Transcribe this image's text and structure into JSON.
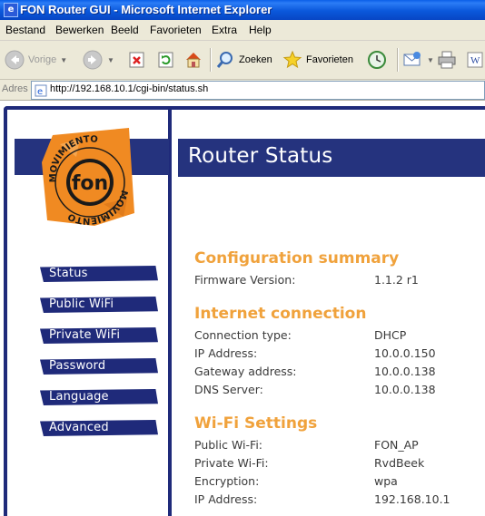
{
  "window": {
    "title": "FON Router GUI - Microsoft Internet Explorer"
  },
  "menu": [
    "Bestand",
    "Bewerken",
    "Beeld",
    "Favorieten",
    "Extra",
    "Help"
  ],
  "toolbar": {
    "back_label": "Vorige",
    "search_label": "Zoeken",
    "favorites_label": "Favorieten"
  },
  "address": {
    "label": "Adres",
    "url": "http://192.168.10.1/cgi-bin/status.sh"
  },
  "logo": {
    "top_text": "MOVIMIENTO",
    "bottom_text": "MOVIMIENTO",
    "center_text": "fon"
  },
  "nav": [
    "Status",
    "Public WiFi",
    "Private WiFi",
    "Password",
    "Language",
    "Advanced"
  ],
  "page": {
    "title": "Router Status"
  },
  "sections": [
    {
      "title": "Configuration summary",
      "rows": [
        {
          "label": "Firmware Version:",
          "value": "1.1.2 r1"
        }
      ]
    },
    {
      "title": "Internet connection",
      "rows": [
        {
          "label": "Connection type:",
          "value": "DHCP"
        },
        {
          "label": "IP Address:",
          "value": "10.0.0.150"
        },
        {
          "label": "Gateway address:",
          "value": "10.0.0.138"
        },
        {
          "label": "DNS Server:",
          "value": "10.0.0.138"
        }
      ]
    },
    {
      "title": "Wi-Fi Settings",
      "rows": [
        {
          "label": "Public Wi-Fi:",
          "value": "FON_AP"
        },
        {
          "label": "Private Wi-Fi:",
          "value": "RvdBeek"
        },
        {
          "label": "Encryption:",
          "value": "wpa"
        },
        {
          "label": "IP Address:",
          "value": "192.168.10.1"
        }
      ]
    }
  ],
  "colors": {
    "navy": "#1f2a7a",
    "section_orange": "#f0a23c",
    "logo_orange": "#f08a22"
  }
}
